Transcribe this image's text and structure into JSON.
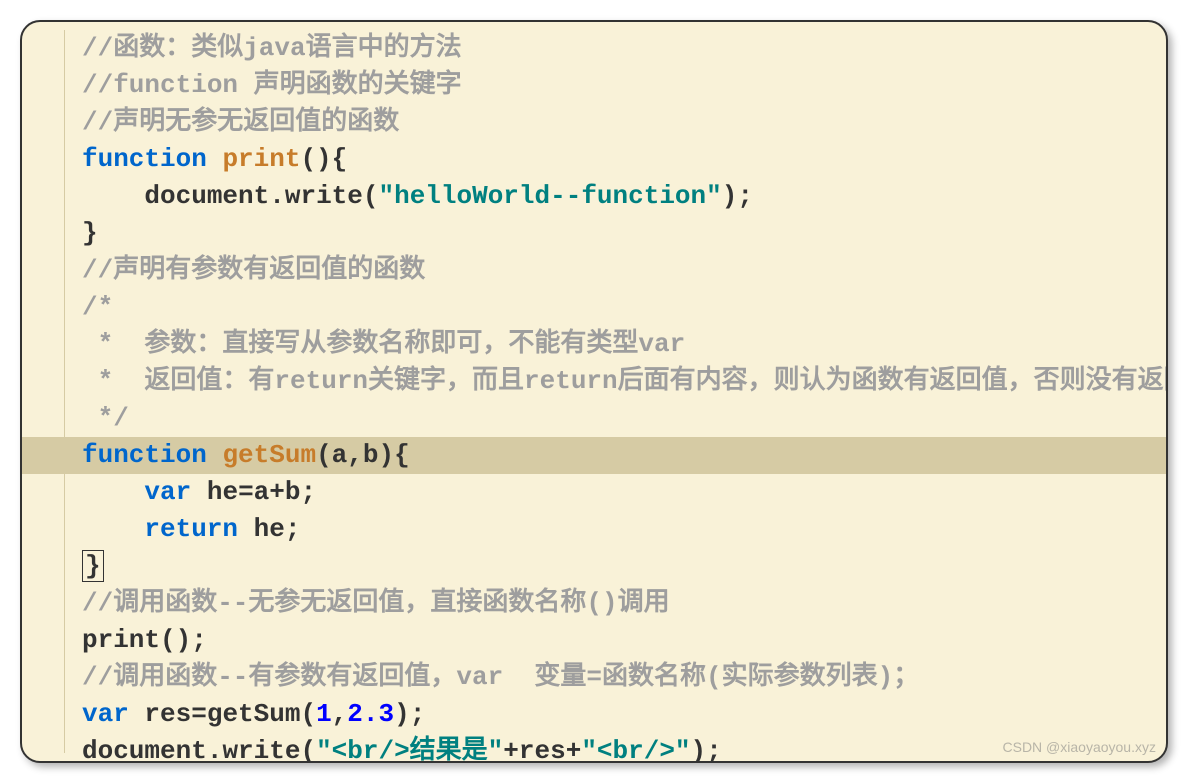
{
  "code": {
    "lines": [
      {
        "indent": 0,
        "hl": false,
        "tokens": [
          {
            "t": "//函数：类似java语言中的方法",
            "c": "comment"
          }
        ]
      },
      {
        "indent": 0,
        "hl": false,
        "tokens": [
          {
            "t": "//function 声明函数的关键字",
            "c": "comment"
          }
        ]
      },
      {
        "indent": 0,
        "hl": false,
        "tokens": [
          {
            "t": "//声明无参无返回值的函数",
            "c": "comment"
          }
        ]
      },
      {
        "indent": 0,
        "hl": false,
        "tokens": [
          {
            "t": "function",
            "c": "keyword"
          },
          {
            "t": " ",
            "c": "punct"
          },
          {
            "t": "print",
            "c": "funcname"
          },
          {
            "t": "(){",
            "c": "punct"
          }
        ]
      },
      {
        "indent": 1,
        "hl": false,
        "tokens": [
          {
            "t": "document",
            "c": "ident"
          },
          {
            "t": ".",
            "c": "punct"
          },
          {
            "t": "write",
            "c": "method"
          },
          {
            "t": "(",
            "c": "punct"
          },
          {
            "t": "\"helloWorld--function\"",
            "c": "string"
          },
          {
            "t": ");",
            "c": "punct"
          }
        ]
      },
      {
        "indent": 0,
        "hl": false,
        "tokens": [
          {
            "t": "}",
            "c": "punct"
          }
        ]
      },
      {
        "indent": 0,
        "hl": false,
        "tokens": [
          {
            "t": "//声明有参数有返回值的函数",
            "c": "comment"
          }
        ]
      },
      {
        "indent": 0,
        "hl": false,
        "tokens": [
          {
            "t": "/*",
            "c": "comment"
          }
        ]
      },
      {
        "indent": 0,
        "hl": false,
        "tokens": [
          {
            "t": " *  参数：直接写从参数名称即可，不能有类型var",
            "c": "comment"
          }
        ]
      },
      {
        "indent": 0,
        "hl": false,
        "tokens": [
          {
            "t": " *  返回值：有return关键字，而且return后面有内容，则认为函数有返回值，否则没有返回值；",
            "c": "comment"
          }
        ]
      },
      {
        "indent": 0,
        "hl": false,
        "tokens": [
          {
            "t": " */",
            "c": "comment"
          }
        ]
      },
      {
        "indent": 0,
        "hl": true,
        "tokens": [
          {
            "t": "function",
            "c": "keyword"
          },
          {
            "t": " ",
            "c": "punct"
          },
          {
            "t": "getSum",
            "c": "funcname"
          },
          {
            "t": "(",
            "c": "punct"
          },
          {
            "t": "a",
            "c": "ident"
          },
          {
            "t": ",",
            "c": "punct"
          },
          {
            "t": "b",
            "c": "ident"
          },
          {
            "t": "){",
            "c": "punct"
          }
        ]
      },
      {
        "indent": 1,
        "hl": false,
        "tokens": [
          {
            "t": "var",
            "c": "keyword"
          },
          {
            "t": " ",
            "c": "punct"
          },
          {
            "t": "he",
            "c": "ident"
          },
          {
            "t": "=",
            "c": "punct"
          },
          {
            "t": "a",
            "c": "ident"
          },
          {
            "t": "+",
            "c": "punct"
          },
          {
            "t": "b",
            "c": "ident"
          },
          {
            "t": ";",
            "c": "punct"
          }
        ]
      },
      {
        "indent": 1,
        "hl": false,
        "tokens": [
          {
            "t": "return",
            "c": "keyword"
          },
          {
            "t": " ",
            "c": "punct"
          },
          {
            "t": "he",
            "c": "ident"
          },
          {
            "t": ";",
            "c": "punct"
          }
        ]
      },
      {
        "indent": 0,
        "hl": false,
        "cursor": true,
        "tokens": [
          {
            "t": "}",
            "c": "punct"
          }
        ]
      },
      {
        "indent": 0,
        "hl": false,
        "tokens": [
          {
            "t": "//调用函数--无参无返回值，直接函数名称()调用",
            "c": "comment"
          }
        ]
      },
      {
        "indent": 0,
        "hl": false,
        "tokens": [
          {
            "t": "print",
            "c": "ident"
          },
          {
            "t": "();",
            "c": "punct"
          }
        ]
      },
      {
        "indent": 0,
        "hl": false,
        "tokens": [
          {
            "t": "//调用函数--有参数有返回值，var  变量=函数名称(实际参数列表)；",
            "c": "comment"
          }
        ]
      },
      {
        "indent": 0,
        "hl": false,
        "tokens": [
          {
            "t": "var",
            "c": "keyword"
          },
          {
            "t": " ",
            "c": "punct"
          },
          {
            "t": "res",
            "c": "ident"
          },
          {
            "t": "=",
            "c": "punct"
          },
          {
            "t": "getSum",
            "c": "ident"
          },
          {
            "t": "(",
            "c": "punct"
          },
          {
            "t": "1",
            "c": "number"
          },
          {
            "t": ",",
            "c": "punct"
          },
          {
            "t": "2.3",
            "c": "number"
          },
          {
            "t": ");",
            "c": "punct"
          }
        ]
      },
      {
        "indent": 0,
        "hl": false,
        "tokens": [
          {
            "t": "document",
            "c": "ident"
          },
          {
            "t": ".",
            "c": "punct"
          },
          {
            "t": "write",
            "c": "method"
          },
          {
            "t": "(",
            "c": "punct"
          },
          {
            "t": "\"<br/>结果是\"",
            "c": "string"
          },
          {
            "t": "+",
            "c": "punct"
          },
          {
            "t": "res",
            "c": "ident"
          },
          {
            "t": "+",
            "c": "punct"
          },
          {
            "t": "\"<br/>\"",
            "c": "string"
          },
          {
            "t": ");",
            "c": "punct"
          }
        ]
      }
    ]
  },
  "watermark": "CSDN @xiaoyaoyou.xyz"
}
